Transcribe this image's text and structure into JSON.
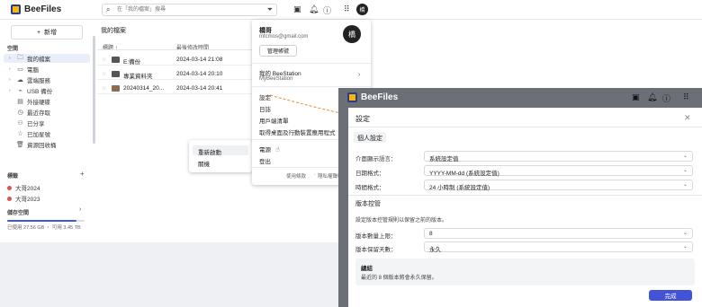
{
  "app": {
    "name": "BeeFiles"
  },
  "search": {
    "placeholder": "在「我的檔案」搜尋"
  },
  "user": {
    "initial": "橋",
    "name": "橋哥",
    "email": "mtcmos@gmail.com"
  },
  "sidebar": {
    "new_label": "新增",
    "section_label": "空間",
    "items": [
      {
        "label": "我的檔案",
        "icon": "folder-icon",
        "active": true
      },
      {
        "label": "電腦",
        "icon": "computer-icon"
      },
      {
        "label": "雲端服務",
        "icon": "cloud-icon"
      },
      {
        "label": "USB 備份",
        "icon": "usb-icon"
      },
      {
        "label": "外接硬碟",
        "icon": "drive-icon"
      },
      {
        "label": "最近存取",
        "icon": "clock-icon"
      },
      {
        "label": "已分享",
        "icon": "share-icon"
      },
      {
        "label": "已加星號",
        "icon": "star-icon"
      },
      {
        "label": "資源回收桶",
        "icon": "trash-icon"
      }
    ],
    "tags_label": "標籤",
    "tags": [
      {
        "label": "大哥2024",
        "color": "#e05151"
      },
      {
        "label": "大哥2023",
        "color": "#e05151"
      }
    ],
    "storage_label": "儲存空間",
    "storage_used_fraction": 0.89,
    "storage_text": "已使用 27.56 GB ・ 可用 3.45 TB"
  },
  "main": {
    "breadcrumb": "我的檔案",
    "col_name": "標題 ↑",
    "col_modified": "最後修改時間",
    "rows": [
      {
        "name": "E:備份",
        "date": "2024-03-14 21:08",
        "type": "folder"
      },
      {
        "name": "專業資料夾",
        "date": "2024-03-14 20:10",
        "type": "folder"
      },
      {
        "name": "20240314_20...",
        "date": "2024-03-14 20:41",
        "type": "image"
      }
    ]
  },
  "context_menu": {
    "items": [
      "重新啟動",
      "關機"
    ]
  },
  "user_menu": {
    "manage_label": "管理帳號",
    "station_label": "我的 BeeStation",
    "station_sub": "MyBeeStation",
    "items": [
      "設定",
      "日誌",
      "用戶端清單",
      "取得桌面及行動裝置應用程式"
    ],
    "power_label": "電源",
    "logout_label": "登出",
    "terms_label": "使用條款",
    "privacy_label": "隱私權聲明"
  },
  "window2": {
    "title": "BeeFiles"
  },
  "settings_dialog": {
    "title": "設定",
    "personal_section": "個人設定",
    "language_label": "介面顯示語言：",
    "language_value": "系統設定值",
    "date_label": "日期格式：",
    "date_value": "YYYY-MM-dd (系統設定值)",
    "time_label": "時間格式：",
    "time_value": "24 小時制 (系統設定值)",
    "version_section": "版本控管",
    "version_desc": "設定版本控管規則以保留之前的版本。",
    "count_label": "版本數量上限：",
    "count_value": "8",
    "keep_label": "版本保留天數：",
    "keep_value": "永久",
    "summary_title": "總結",
    "summary_text": "最近的 8 個版本將會永久保留。",
    "done_label": "完成"
  },
  "colors": {
    "accent": "#4353d8",
    "brand": "#f5b800",
    "tag": "#e05151"
  }
}
